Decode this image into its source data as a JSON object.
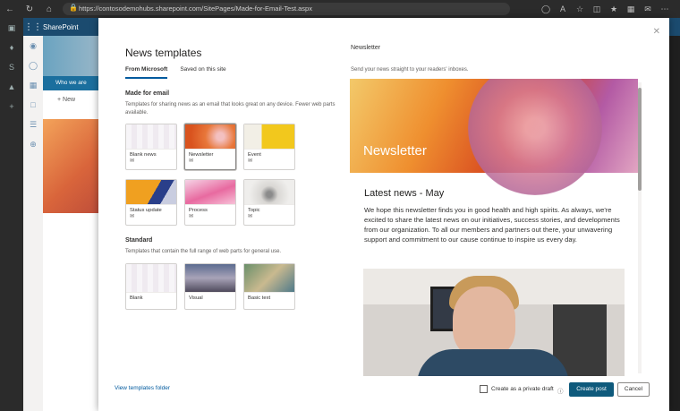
{
  "browser": {
    "url": "https://contosodemohubs.sharepoint.com/SitePages/Made-for-Email-Test.aspx"
  },
  "sharepoint": {
    "app_name": "SharePoint",
    "nav_item": "Who we are",
    "new_label": "New"
  },
  "modal": {
    "title": "News templates",
    "tabs": [
      {
        "label": "From Microsoft",
        "active": true
      },
      {
        "label": "Saved on this site",
        "active": false
      }
    ],
    "made_for_email": {
      "title": "Made for email",
      "description": "Templates for sharing news as an email that looks great on any device. Fewer web parts available.",
      "cards": [
        {
          "label": "Blank news"
        },
        {
          "label": "Newsletter"
        },
        {
          "label": "Event"
        },
        {
          "label": "Status update"
        },
        {
          "label": "Process"
        },
        {
          "label": "Topic"
        }
      ]
    },
    "standard": {
      "title": "Standard",
      "description": "Templates that contain the full range of web parts for general use.",
      "cards": [
        {
          "label": "Blank"
        },
        {
          "label": "Visual"
        },
        {
          "label": "Basic text"
        }
      ]
    },
    "view_folder_link": "View templates folder",
    "preview": {
      "heading": "Newsletter",
      "description": "Send your news straight to your readers' inboxes.",
      "banner_title": "Newsletter",
      "article_title": "Latest news - May",
      "article_body": "We hope this newsletter finds you in good health and high spirits. As always, we're excited to share the latest news on our initiatives, success stories, and developments from our organization. To all our members and partners out there, your unwavering support and commitment to our cause continue to inspire us every day."
    },
    "footer": {
      "draft_label": "Create as a private draft",
      "create_button": "Create post",
      "cancel_button": "Cancel"
    }
  },
  "colors": {
    "primary": "#0f5a7c",
    "link": "#005a9e",
    "header": "#1b4b6f"
  }
}
